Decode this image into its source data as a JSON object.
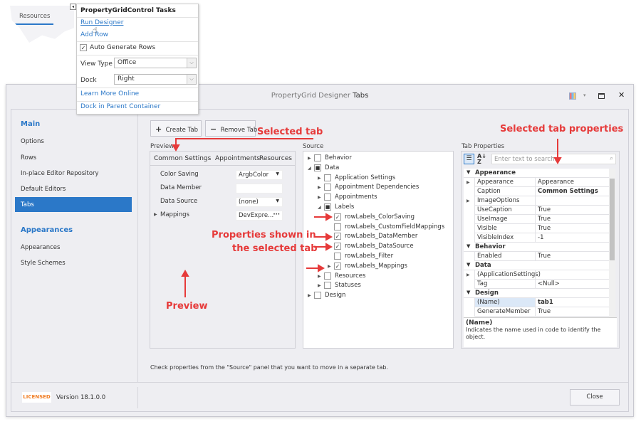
{
  "fragment": {
    "tab": "Resources"
  },
  "tasks": {
    "title": "PropertyGridControl Tasks",
    "run_designer": "Run Designer",
    "add_row": "Add Row",
    "auto_generate": "Auto Generate Rows",
    "auto_generate_checked": true,
    "view_type_label": "View Type",
    "view_type": "Office",
    "dock_label": "Dock",
    "dock": "Right",
    "learn_more": "Learn More Online",
    "dock_parent": "Dock in Parent Container"
  },
  "window": {
    "title_prefix": "PropertyGrid Designer",
    "title_suffix": "Tabs"
  },
  "sidebar": {
    "main": "Main",
    "items": [
      "Options",
      "Rows",
      "In-place Editor Repository",
      "Default Editors",
      "Tabs"
    ],
    "selected": "Tabs",
    "appearances_head": "Appearances",
    "items2": [
      "Appearances",
      "Style Schemes"
    ]
  },
  "toolbar": {
    "create": "Create Tab",
    "remove": "Remove Tab"
  },
  "preview": {
    "label": "Preview",
    "tabs": [
      "Common Settings",
      "Appointments",
      "Resources"
    ],
    "rows": [
      {
        "name": "Color Saving",
        "value": "ArgbColor",
        "type": "dropdown"
      },
      {
        "name": "Data Member",
        "value": "",
        "type": "text"
      },
      {
        "name": "Data Source",
        "value": "(none)",
        "type": "dropdown"
      },
      {
        "name": "Mappings",
        "value": "DevExpre...",
        "type": "ellipsis"
      }
    ]
  },
  "source": {
    "label": "Source",
    "items": [
      {
        "text": "Behavior",
        "level": 0,
        "exp": "collapsed",
        "check": "none"
      },
      {
        "text": "Data",
        "level": 0,
        "exp": "expanded",
        "check": "partial"
      },
      {
        "text": "Application Settings",
        "level": 1,
        "exp": "collapsed",
        "check": "none"
      },
      {
        "text": "Appointment Dependencies",
        "level": 1,
        "exp": "collapsed",
        "check": "none"
      },
      {
        "text": "Appointments",
        "level": 1,
        "exp": "collapsed",
        "check": "none"
      },
      {
        "text": "Labels",
        "level": 1,
        "exp": "expanded",
        "check": "partial"
      },
      {
        "text": "rowLabels_ColorSaving",
        "level": 2,
        "exp": "",
        "check": "checked"
      },
      {
        "text": "rowLabels_CustomFieldMappings",
        "level": 2,
        "exp": "",
        "check": "none"
      },
      {
        "text": "rowLabels_DataMember",
        "level": 2,
        "exp": "",
        "check": "checked"
      },
      {
        "text": "rowLabels_DataSource",
        "level": 2,
        "exp": "",
        "check": "checked"
      },
      {
        "text": "rowLabels_Filter",
        "level": 2,
        "exp": "",
        "check": "none"
      },
      {
        "text": "rowLabels_Mappings",
        "level": 2,
        "exp": "collapsed",
        "check": "checked"
      },
      {
        "text": "Resources",
        "level": 1,
        "exp": "collapsed",
        "check": "none"
      },
      {
        "text": "Statuses",
        "level": 1,
        "exp": "collapsed",
        "check": "none"
      },
      {
        "text": "Design",
        "level": 0,
        "exp": "collapsed",
        "check": "none"
      }
    ]
  },
  "tabprops": {
    "label": "Tab Properties",
    "search_placeholder": "Enter text to search...",
    "rows": [
      {
        "cat": "Appearance"
      },
      {
        "name": "Appearance",
        "value": "Appearance",
        "exp": true
      },
      {
        "name": "Caption",
        "value": "Common Settings",
        "bold": true
      },
      {
        "name": "ImageOptions",
        "value": "",
        "exp": true
      },
      {
        "name": "UseCaption",
        "value": "True"
      },
      {
        "name": "UseImage",
        "value": "True"
      },
      {
        "name": "Visible",
        "value": "True"
      },
      {
        "name": "VisibleIndex",
        "value": "-1"
      },
      {
        "cat": "Behavior"
      },
      {
        "name": "Enabled",
        "value": "True"
      },
      {
        "cat": "Data"
      },
      {
        "name": "(ApplicationSettings)",
        "value": "",
        "exp": true
      },
      {
        "name": "Tag",
        "value": "<Null>"
      },
      {
        "cat": "Design"
      },
      {
        "name": "(Name)",
        "value": "tab1",
        "bold": true,
        "selected": true
      },
      {
        "name": "GenerateMember",
        "value": "True"
      }
    ],
    "desc_title": "(Name)",
    "desc_text": "Indicates the name used in code to identify the object."
  },
  "hint": "Check properties from the \"Source\" panel that you want to move in a separate tab.",
  "footer": {
    "badge": "LICENSED",
    "version": "Version 18.1.0.0",
    "close": "Close"
  },
  "annotations": {
    "selected_tab": "Selected tab",
    "selected_tab_props": "Selected tab properties",
    "props_shown_1": "Properties shown in",
    "props_shown_2": "the selected tab",
    "preview": "Preview"
  },
  "colors": {
    "accent": "#2b78c8",
    "annotation": "#e63a3a",
    "badge": "#f07b22"
  }
}
